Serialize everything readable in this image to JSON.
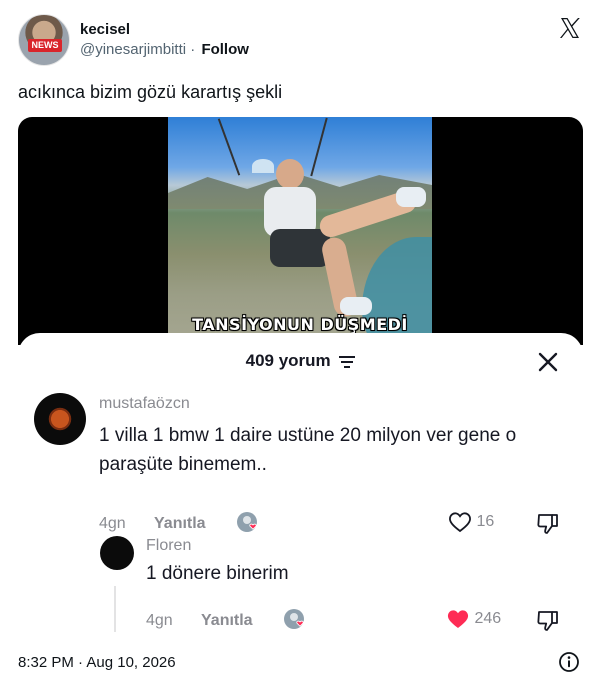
{
  "tweet": {
    "author_name": "kecisel",
    "handle": "@yinesarjimbitti",
    "separator": "·",
    "follow_label": "Follow",
    "avatar_badge": "NEWS",
    "text": "acıkınca bizim gözü karartış şekli",
    "timestamp": "8:32 PM · Aug 10, 2026"
  },
  "video": {
    "caption": "TANSİYONUN DÜŞMEDİ"
  },
  "comments_sheet": {
    "count_label": "409 yorum",
    "comments": [
      {
        "username": "mustafaözcn",
        "text": "1 villa 1 bmw 1 daire ustüne 20 milyon ver gene o paraşüte binemem..",
        "age": "4gn",
        "reply_label": "Yanıtla",
        "likes": "16",
        "liked": false
      },
      {
        "username": "Floren",
        "text": "1 dönere binerim",
        "age": "4gn",
        "reply_label": "Yanıtla",
        "likes": "246",
        "liked": true
      }
    ]
  },
  "colors": {
    "like_active": "#fe2c55",
    "muted_text": "#8a8b91",
    "primary_text": "#161823"
  },
  "icons": [
    "x-logo-icon",
    "filter-icon",
    "close-icon",
    "heart-icon",
    "dislike-icon",
    "info-icon"
  ]
}
